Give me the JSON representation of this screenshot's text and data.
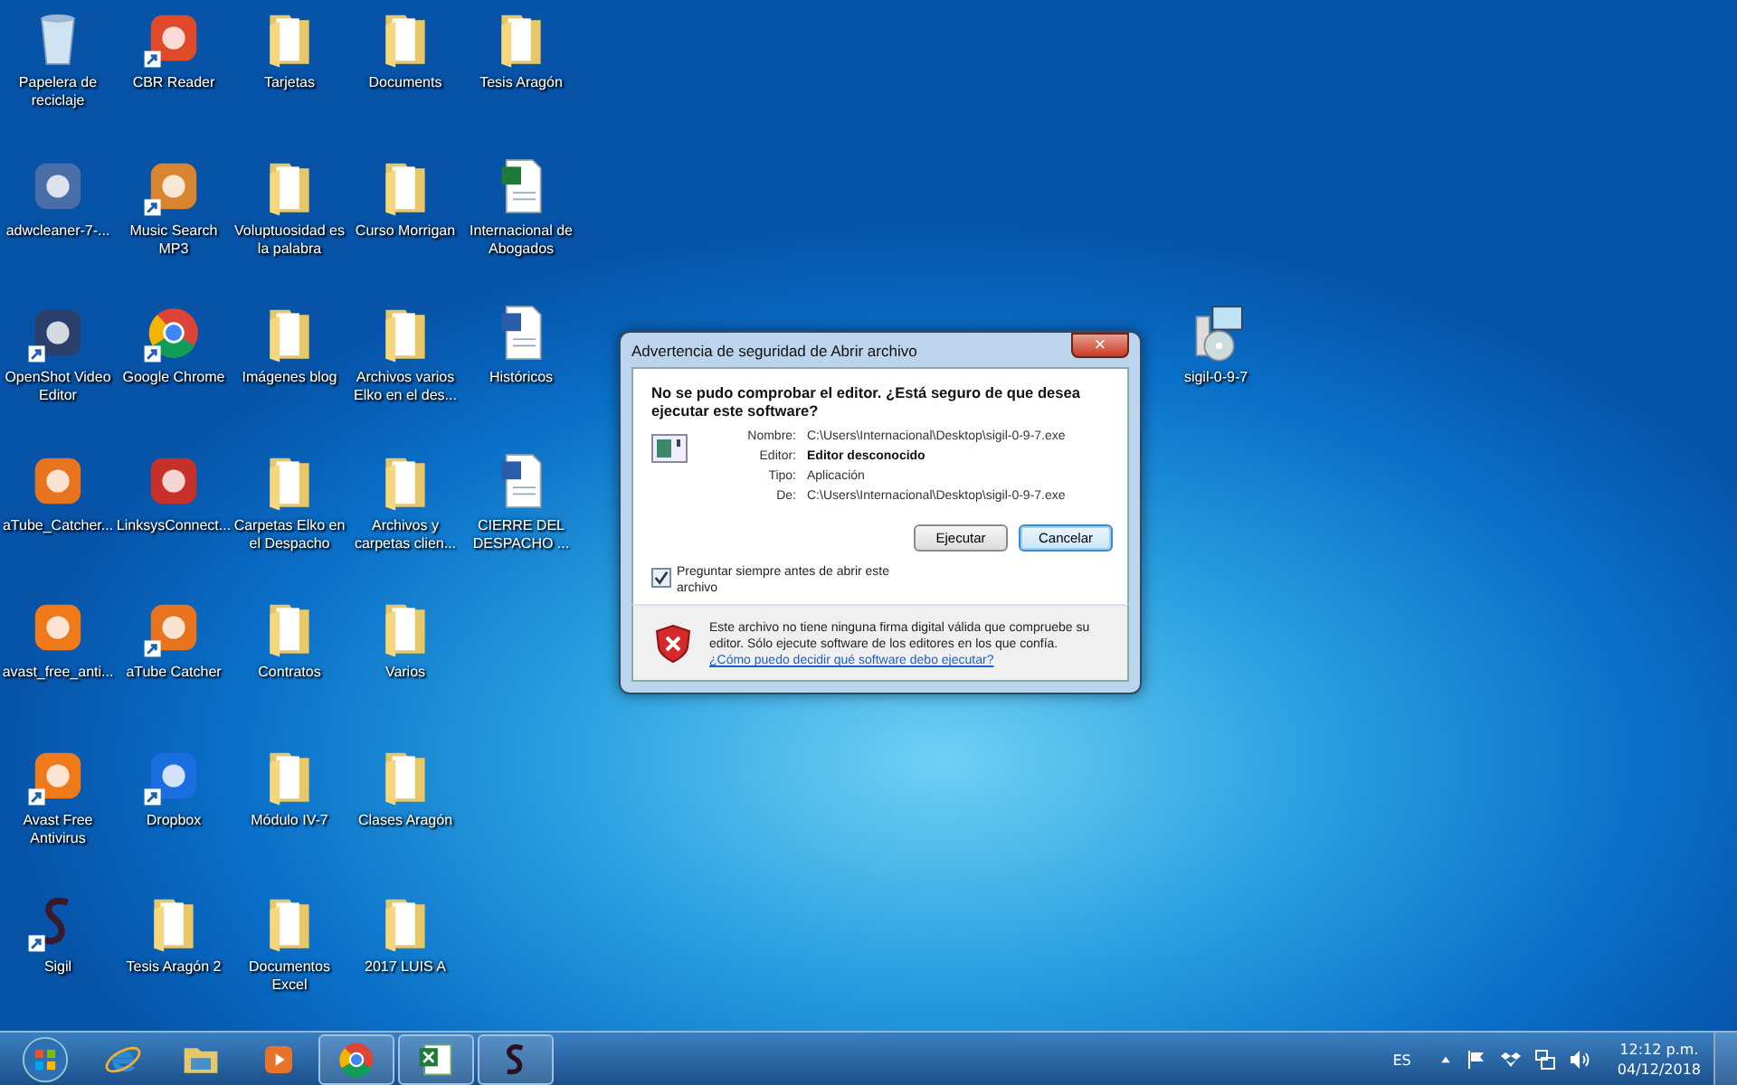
{
  "desktop_icons": [
    {
      "label": "Papelera de reciclaje",
      "kind": "recycle",
      "shortcut": false
    },
    {
      "label": "adwcleaner-7-...",
      "kind": "app",
      "color": "#4a6fa8",
      "shortcut": false
    },
    {
      "label": "OpenShot Video Editor",
      "kind": "app",
      "color": "#2a3f6a",
      "shortcut": true
    },
    {
      "label": "aTube_Catcher...",
      "kind": "app",
      "color": "#e8741e",
      "shortcut": false
    },
    {
      "label": "avast_free_anti...",
      "kind": "app",
      "color": "#f07a1a",
      "shortcut": false
    },
    {
      "label": "Avast Free Antivirus",
      "kind": "app",
      "color": "#f07a1a",
      "shortcut": true
    },
    {
      "label": "Sigil",
      "kind": "sigil",
      "shortcut": true
    },
    {
      "label": "CBR Reader",
      "kind": "app",
      "color": "#e04a2a",
      "shortcut": true
    },
    {
      "label": "Music Search MP3",
      "kind": "app",
      "color": "#d9852f",
      "shortcut": true
    },
    {
      "label": "Google Chrome",
      "kind": "chrome",
      "shortcut": true
    },
    {
      "label": "LinksysConnect...",
      "kind": "app",
      "color": "#c8302a",
      "shortcut": false
    },
    {
      "label": "aTube Catcher",
      "kind": "app",
      "color": "#e8741e",
      "shortcut": true
    },
    {
      "label": "Dropbox",
      "kind": "app",
      "color": "#1a6ee0",
      "shortcut": true
    },
    {
      "label": "Tesis Aragón 2",
      "kind": "folder",
      "shortcut": false
    },
    {
      "label": "Tarjetas",
      "kind": "folder",
      "shortcut": false
    },
    {
      "label": "Voluptuosidad es la palabra",
      "kind": "folder",
      "shortcut": false
    },
    {
      "label": "Imágenes blog",
      "kind": "folder",
      "shortcut": false
    },
    {
      "label": "Carpetas Elko en el Despacho",
      "kind": "folder",
      "shortcut": false
    },
    {
      "label": "Contratos",
      "kind": "folder",
      "shortcut": false
    },
    {
      "label": "Módulo IV-7",
      "kind": "folder",
      "shortcut": false
    },
    {
      "label": "Documentos Excel",
      "kind": "folder",
      "shortcut": false
    },
    {
      "label": "Documents",
      "kind": "folder",
      "shortcut": false
    },
    {
      "label": "Curso Morrigan",
      "kind": "folder",
      "shortcut": false
    },
    {
      "label": "Archivos varios Elko en el des...",
      "kind": "folder",
      "shortcut": false
    },
    {
      "label": "Archivos y carpetas clien...",
      "kind": "folder",
      "shortcut": false
    },
    {
      "label": "Varios",
      "kind": "folder",
      "shortcut": false
    },
    {
      "label": "Clases Aragón",
      "kind": "folder",
      "shortcut": false
    },
    {
      "label": "2017 LUIS A",
      "kind": "folder",
      "shortcut": false
    },
    {
      "label": "Tesis Aragón",
      "kind": "folder",
      "shortcut": false
    },
    {
      "label": "Internacional de Abogados",
      "kind": "excel",
      "shortcut": false
    },
    {
      "label": "Históricos",
      "kind": "word",
      "shortcut": false
    },
    {
      "label": "CIERRE DEL DESPACHO ...",
      "kind": "word",
      "shortcut": false
    }
  ],
  "loose_icon": {
    "label": "sigil-0-9-7"
  },
  "dialog": {
    "title": "Advertencia de seguridad de Abrir archivo",
    "close": "×",
    "question": "No se pudo comprobar el editor. ¿Está seguro de que desea ejecutar este software?",
    "fields": [
      {
        "label": "Nombre:",
        "value": "C:\\Users\\Internacional\\Desktop\\sigil-0-9-7.exe",
        "bold": false
      },
      {
        "label": "Editor:",
        "value": "Editor desconocido",
        "bold": true
      },
      {
        "label": "Tipo:",
        "value": "Aplicación",
        "bold": false
      },
      {
        "label": "De:",
        "value": "C:\\Users\\Internacional\\Desktop\\sigil-0-9-7.exe",
        "bold": false
      }
    ],
    "buttons": [
      {
        "label": "Ejecutar",
        "selected": false
      },
      {
        "label": "Cancelar",
        "selected": true
      }
    ],
    "checkbox": {
      "label": "Preguntar siempre antes de abrir este archivo",
      "checked": true
    },
    "warning": "Este archivo no tiene ninguna firma digital válida que compruebe su editor. Sólo ejecute software de los editores en los que confía.",
    "link": "¿Cómo puedo decidir qué software debo ejecutar?"
  },
  "taskbar": {
    "items": [
      {
        "kind": "start",
        "running": false
      },
      {
        "kind": "ie",
        "running": false
      },
      {
        "kind": "explorer",
        "running": false
      },
      {
        "kind": "media",
        "running": false
      },
      {
        "kind": "chrome",
        "running": true
      },
      {
        "kind": "excel",
        "running": true
      },
      {
        "kind": "sigil",
        "running": true
      }
    ],
    "language": "ES",
    "time": "12:12 p.m.",
    "date": "04/12/2018"
  }
}
